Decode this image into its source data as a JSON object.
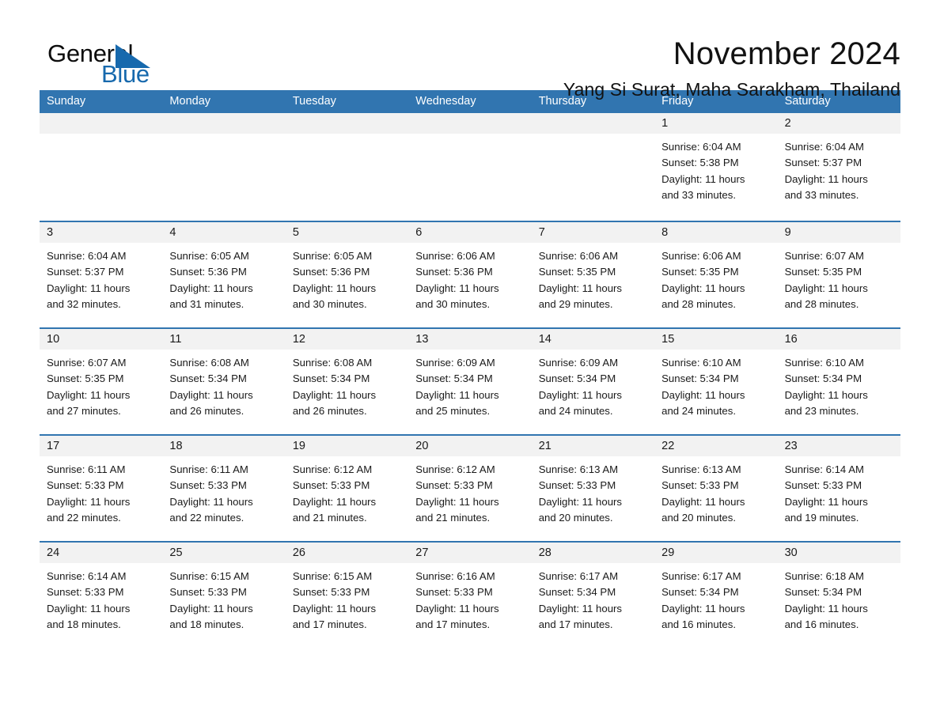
{
  "brand": {
    "name_part1": "General",
    "name_part2": "Blue",
    "accent_color": "#1769ad"
  },
  "header": {
    "month_title": "November 2024",
    "location": "Yang Si Surat, Maha Sarakham, Thailand",
    "header_bg_color": "#3175b0",
    "daynum_band_color": "#f2f2f2"
  },
  "calendar": {
    "weekdays": [
      "Sunday",
      "Monday",
      "Tuesday",
      "Wednesday",
      "Thursday",
      "Friday",
      "Saturday"
    ],
    "weeks": [
      [
        {
          "day": "",
          "sunrise": "",
          "sunset": "",
          "daylight_line1": "",
          "daylight_line2": "",
          "empty": true
        },
        {
          "day": "",
          "sunrise": "",
          "sunset": "",
          "daylight_line1": "",
          "daylight_line2": "",
          "empty": true
        },
        {
          "day": "",
          "sunrise": "",
          "sunset": "",
          "daylight_line1": "",
          "daylight_line2": "",
          "empty": true
        },
        {
          "day": "",
          "sunrise": "",
          "sunset": "",
          "daylight_line1": "",
          "daylight_line2": "",
          "empty": true
        },
        {
          "day": "",
          "sunrise": "",
          "sunset": "",
          "daylight_line1": "",
          "daylight_line2": "",
          "empty": true
        },
        {
          "day": "1",
          "sunrise": "Sunrise: 6:04 AM",
          "sunset": "Sunset: 5:38 PM",
          "daylight_line1": "Daylight: 11 hours",
          "daylight_line2": "and 33 minutes.",
          "empty": false
        },
        {
          "day": "2",
          "sunrise": "Sunrise: 6:04 AM",
          "sunset": "Sunset: 5:37 PM",
          "daylight_line1": "Daylight: 11 hours",
          "daylight_line2": "and 33 minutes.",
          "empty": false
        }
      ],
      [
        {
          "day": "3",
          "sunrise": "Sunrise: 6:04 AM",
          "sunset": "Sunset: 5:37 PM",
          "daylight_line1": "Daylight: 11 hours",
          "daylight_line2": "and 32 minutes.",
          "empty": false
        },
        {
          "day": "4",
          "sunrise": "Sunrise: 6:05 AM",
          "sunset": "Sunset: 5:36 PM",
          "daylight_line1": "Daylight: 11 hours",
          "daylight_line2": "and 31 minutes.",
          "empty": false
        },
        {
          "day": "5",
          "sunrise": "Sunrise: 6:05 AM",
          "sunset": "Sunset: 5:36 PM",
          "daylight_line1": "Daylight: 11 hours",
          "daylight_line2": "and 30 minutes.",
          "empty": false
        },
        {
          "day": "6",
          "sunrise": "Sunrise: 6:06 AM",
          "sunset": "Sunset: 5:36 PM",
          "daylight_line1": "Daylight: 11 hours",
          "daylight_line2": "and 30 minutes.",
          "empty": false
        },
        {
          "day": "7",
          "sunrise": "Sunrise: 6:06 AM",
          "sunset": "Sunset: 5:35 PM",
          "daylight_line1": "Daylight: 11 hours",
          "daylight_line2": "and 29 minutes.",
          "empty": false
        },
        {
          "day": "8",
          "sunrise": "Sunrise: 6:06 AM",
          "sunset": "Sunset: 5:35 PM",
          "daylight_line1": "Daylight: 11 hours",
          "daylight_line2": "and 28 minutes.",
          "empty": false
        },
        {
          "day": "9",
          "sunrise": "Sunrise: 6:07 AM",
          "sunset": "Sunset: 5:35 PM",
          "daylight_line1": "Daylight: 11 hours",
          "daylight_line2": "and 28 minutes.",
          "empty": false
        }
      ],
      [
        {
          "day": "10",
          "sunrise": "Sunrise: 6:07 AM",
          "sunset": "Sunset: 5:35 PM",
          "daylight_line1": "Daylight: 11 hours",
          "daylight_line2": "and 27 minutes.",
          "empty": false
        },
        {
          "day": "11",
          "sunrise": "Sunrise: 6:08 AM",
          "sunset": "Sunset: 5:34 PM",
          "daylight_line1": "Daylight: 11 hours",
          "daylight_line2": "and 26 minutes.",
          "empty": false
        },
        {
          "day": "12",
          "sunrise": "Sunrise: 6:08 AM",
          "sunset": "Sunset: 5:34 PM",
          "daylight_line1": "Daylight: 11 hours",
          "daylight_line2": "and 26 minutes.",
          "empty": false
        },
        {
          "day": "13",
          "sunrise": "Sunrise: 6:09 AM",
          "sunset": "Sunset: 5:34 PM",
          "daylight_line1": "Daylight: 11 hours",
          "daylight_line2": "and 25 minutes.",
          "empty": false
        },
        {
          "day": "14",
          "sunrise": "Sunrise: 6:09 AM",
          "sunset": "Sunset: 5:34 PM",
          "daylight_line1": "Daylight: 11 hours",
          "daylight_line2": "and 24 minutes.",
          "empty": false
        },
        {
          "day": "15",
          "sunrise": "Sunrise: 6:10 AM",
          "sunset": "Sunset: 5:34 PM",
          "daylight_line1": "Daylight: 11 hours",
          "daylight_line2": "and 24 minutes.",
          "empty": false
        },
        {
          "day": "16",
          "sunrise": "Sunrise: 6:10 AM",
          "sunset": "Sunset: 5:34 PM",
          "daylight_line1": "Daylight: 11 hours",
          "daylight_line2": "and 23 minutes.",
          "empty": false
        }
      ],
      [
        {
          "day": "17",
          "sunrise": "Sunrise: 6:11 AM",
          "sunset": "Sunset: 5:33 PM",
          "daylight_line1": "Daylight: 11 hours",
          "daylight_line2": "and 22 minutes.",
          "empty": false
        },
        {
          "day": "18",
          "sunrise": "Sunrise: 6:11 AM",
          "sunset": "Sunset: 5:33 PM",
          "daylight_line1": "Daylight: 11 hours",
          "daylight_line2": "and 22 minutes.",
          "empty": false
        },
        {
          "day": "19",
          "sunrise": "Sunrise: 6:12 AM",
          "sunset": "Sunset: 5:33 PM",
          "daylight_line1": "Daylight: 11 hours",
          "daylight_line2": "and 21 minutes.",
          "empty": false
        },
        {
          "day": "20",
          "sunrise": "Sunrise: 6:12 AM",
          "sunset": "Sunset: 5:33 PM",
          "daylight_line1": "Daylight: 11 hours",
          "daylight_line2": "and 21 minutes.",
          "empty": false
        },
        {
          "day": "21",
          "sunrise": "Sunrise: 6:13 AM",
          "sunset": "Sunset: 5:33 PM",
          "daylight_line1": "Daylight: 11 hours",
          "daylight_line2": "and 20 minutes.",
          "empty": false
        },
        {
          "day": "22",
          "sunrise": "Sunrise: 6:13 AM",
          "sunset": "Sunset: 5:33 PM",
          "daylight_line1": "Daylight: 11 hours",
          "daylight_line2": "and 20 minutes.",
          "empty": false
        },
        {
          "day": "23",
          "sunrise": "Sunrise: 6:14 AM",
          "sunset": "Sunset: 5:33 PM",
          "daylight_line1": "Daylight: 11 hours",
          "daylight_line2": "and 19 minutes.",
          "empty": false
        }
      ],
      [
        {
          "day": "24",
          "sunrise": "Sunrise: 6:14 AM",
          "sunset": "Sunset: 5:33 PM",
          "daylight_line1": "Daylight: 11 hours",
          "daylight_line2": "and 18 minutes.",
          "empty": false
        },
        {
          "day": "25",
          "sunrise": "Sunrise: 6:15 AM",
          "sunset": "Sunset: 5:33 PM",
          "daylight_line1": "Daylight: 11 hours",
          "daylight_line2": "and 18 minutes.",
          "empty": false
        },
        {
          "day": "26",
          "sunrise": "Sunrise: 6:15 AM",
          "sunset": "Sunset: 5:33 PM",
          "daylight_line1": "Daylight: 11 hours",
          "daylight_line2": "and 17 minutes.",
          "empty": false
        },
        {
          "day": "27",
          "sunrise": "Sunrise: 6:16 AM",
          "sunset": "Sunset: 5:33 PM",
          "daylight_line1": "Daylight: 11 hours",
          "daylight_line2": "and 17 minutes.",
          "empty": false
        },
        {
          "day": "28",
          "sunrise": "Sunrise: 6:17 AM",
          "sunset": "Sunset: 5:34 PM",
          "daylight_line1": "Daylight: 11 hours",
          "daylight_line2": "and 17 minutes.",
          "empty": false
        },
        {
          "day": "29",
          "sunrise": "Sunrise: 6:17 AM",
          "sunset": "Sunset: 5:34 PM",
          "daylight_line1": "Daylight: 11 hours",
          "daylight_line2": "and 16 minutes.",
          "empty": false
        },
        {
          "day": "30",
          "sunrise": "Sunrise: 6:18 AM",
          "sunset": "Sunset: 5:34 PM",
          "daylight_line1": "Daylight: 11 hours",
          "daylight_line2": "and 16 minutes.",
          "empty": false
        }
      ]
    ]
  }
}
